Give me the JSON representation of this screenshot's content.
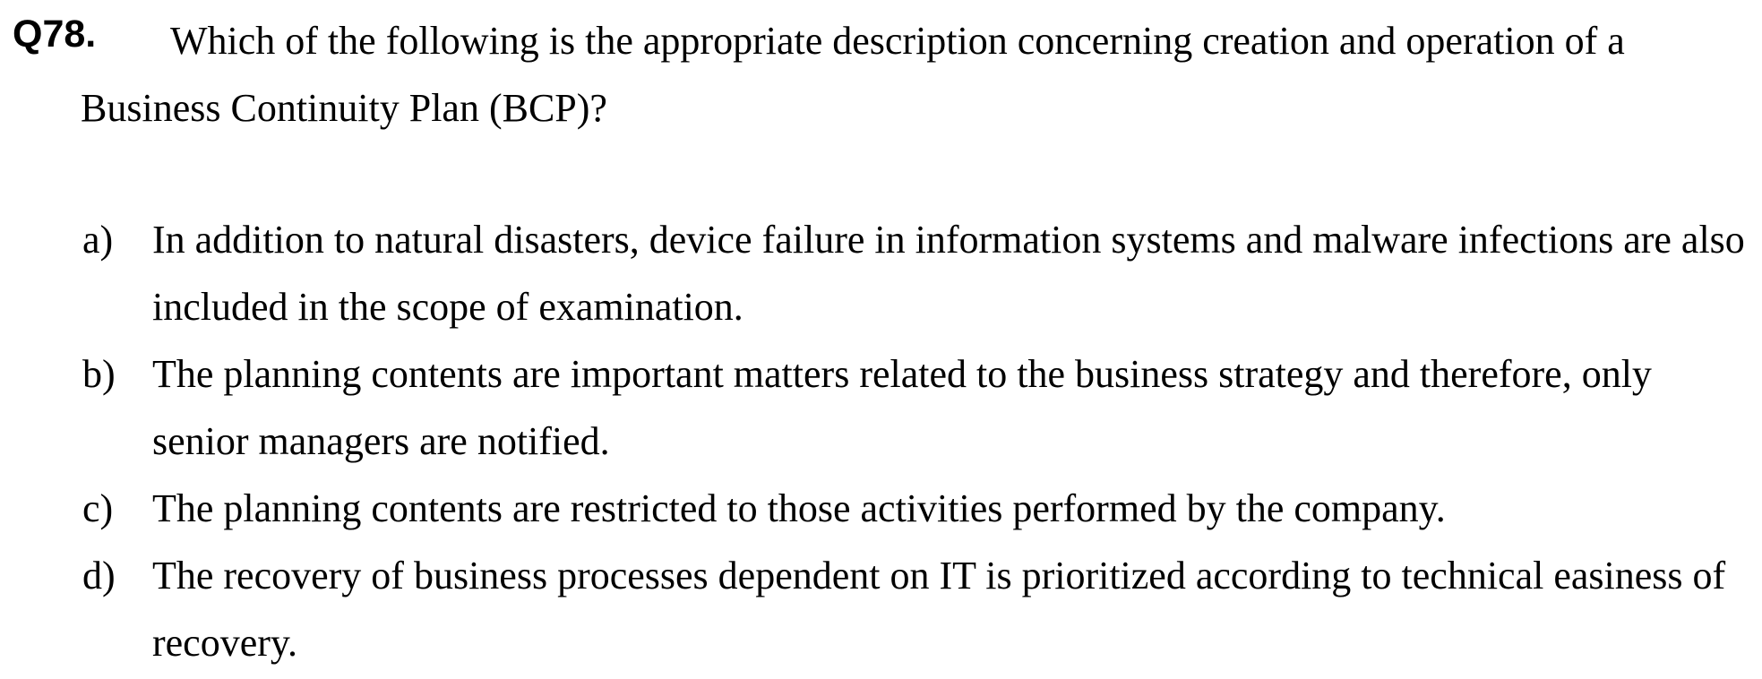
{
  "question": {
    "number": "Q78.",
    "text": "Which of the following is the appropriate description concerning creation and operation of a Business Continuity Plan (BCP)?"
  },
  "options": [
    {
      "label": "a)",
      "text": "In addition to natural disasters, device failure in information systems and malware infections are also included in the scope of examination."
    },
    {
      "label": "b)",
      "text": "The planning contents are important matters related to the business strategy and therefore, only senior managers are notified."
    },
    {
      "label": "c)",
      "text": "The planning contents are restricted to those activities performed by the company."
    },
    {
      "label": "d)",
      "text": "The recovery of business processes dependent on IT is prioritized according to technical easiness of recovery."
    }
  ]
}
